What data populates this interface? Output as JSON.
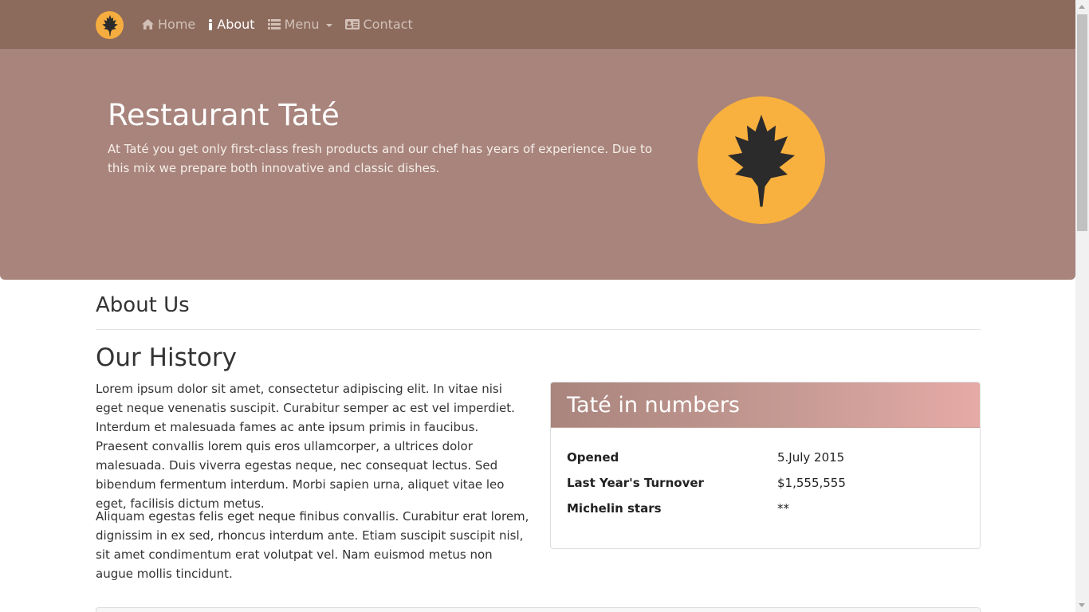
{
  "nav": {
    "brand_icon": "leaf-icon",
    "items": [
      {
        "label": "Home",
        "icon": "home-icon",
        "active": false
      },
      {
        "label": "About",
        "icon": "info-icon",
        "active": true
      },
      {
        "label": "Menu",
        "icon": "list-icon",
        "active": false,
        "dropdown": true
      },
      {
        "label": "Contact",
        "icon": "contact-card-icon",
        "active": false
      }
    ]
  },
  "hero": {
    "title": "Restaurant Taté",
    "text": "At Taté you get only first-class fresh products and our chef has years of experience. Due to this mix we prepare both innovative and classic dishes.",
    "logo_icon": "leaf-icon"
  },
  "about": {
    "title": "About Us"
  },
  "history": {
    "title": "Our History",
    "paragraphs": [
      "Lorem ipsum dolor sit amet, consectetur adipiscing elit. In vitae nisi eget neque venenatis suscipit. Curabitur semper ac est vel imperdiet. Interdum et malesuada fames ac ante ipsum primis in faucibus. Praesent convallis lorem quis eros ullamcorper, a ultrices dolor malesuada. Duis viverra egestas neque, nec consequat lectus. Sed bibendum fermentum interdum. Morbi sapien urna, aliquet vitae leo eget, facilisis dictum metus.",
      "Aliquam egestas felis eget neque finibus convallis. Curabitur erat lorem, dignissim in ex sed, rhoncus interdum ante. Etiam suscipit suscipit nisl, sit amet condimentum erat volutpat vel. Nam euismod metus non augue mollis tincidunt."
    ]
  },
  "numbers": {
    "title": "Taté in numbers",
    "rows": [
      {
        "label": "Opened",
        "value": "5.July 2015"
      },
      {
        "label": "Last Year's Turnover",
        "value": "$1,555,555"
      },
      {
        "label": "Michelin stars",
        "value": "**"
      }
    ]
  },
  "colors": {
    "navbar": "#8c6b5d",
    "hero": "#a8847c",
    "logo": "#f8b03f",
    "panel_gradient_end": "#e6aaa6"
  }
}
